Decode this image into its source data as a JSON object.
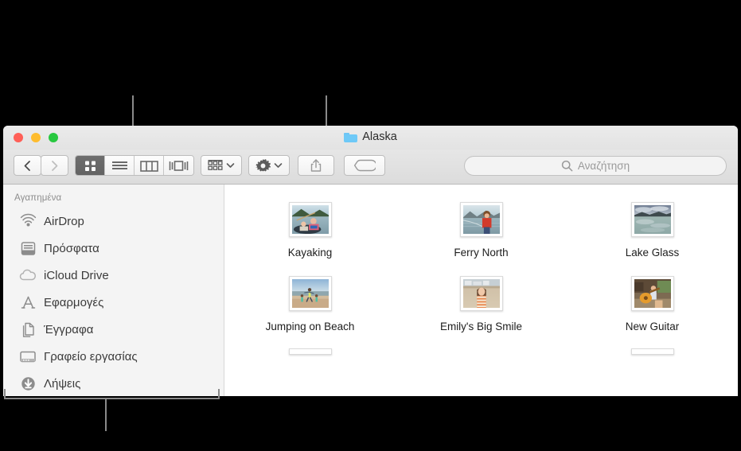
{
  "window": {
    "title": "Alaska",
    "folder_icon": "folder-icon",
    "traffic_lights": {
      "close": "#ff5f57",
      "minimize": "#febc2e",
      "maximize": "#28c840"
    }
  },
  "toolbar": {
    "back_label": "‹",
    "forward_label": "›",
    "view_modes": [
      {
        "name": "icon-view",
        "icon": "grid-icon",
        "selected": true
      },
      {
        "name": "list-view",
        "icon": "list-icon",
        "selected": false
      },
      {
        "name": "column-view",
        "icon": "columns-icon",
        "selected": false
      },
      {
        "name": "gallery-view",
        "icon": "coverflow-icon",
        "selected": false
      }
    ],
    "arrange_button": {
      "name": "arrange-button",
      "icon": "arrange-grid-icon"
    },
    "action_button": {
      "name": "action-button",
      "icon": "gear-icon"
    },
    "share_button": {
      "name": "share-button",
      "icon": "share-upload-icon"
    },
    "tags_button": {
      "name": "tags-button",
      "icon": "tag-icon"
    }
  },
  "search": {
    "placeholder": "Αναζήτηση",
    "value": "",
    "icon": "search-icon"
  },
  "sidebar": {
    "header": "Αγαπημένα",
    "items": [
      {
        "label": "AirDrop",
        "icon": "airdrop-icon"
      },
      {
        "label": "Πρόσφατα",
        "icon": "recents-icon"
      },
      {
        "label": "iCloud Drive",
        "icon": "cloud-icon"
      },
      {
        "label": "Εφαρμογές",
        "icon": "applications-icon"
      },
      {
        "label": "Έγγραφα",
        "icon": "documents-icon"
      },
      {
        "label": "Γραφείο εργασίας",
        "icon": "desktop-icon"
      },
      {
        "label": "Λήψεις",
        "icon": "downloads-icon"
      }
    ]
  },
  "content": {
    "rows": [
      [
        {
          "label": "Kayaking",
          "thumb": "kayaking-photo"
        },
        {
          "label": "Ferry North",
          "thumb": "ferry-north-photo"
        },
        {
          "label": "Lake Glass",
          "thumb": "lake-glass-photo"
        }
      ],
      [
        {
          "label": "Jumping on Beach",
          "thumb": "jumping-on-beach-photo"
        },
        {
          "label": "Emily's Big Smile",
          "thumb": "emilys-big-smile-photo"
        },
        {
          "label": "New Guitar",
          "thumb": "new-guitar-photo"
        }
      ]
    ]
  },
  "callouts": {
    "view_buttons_pointer": "points to the view-mode button group",
    "share_button_pointer": "points to the share and tags buttons",
    "sidebar_pointer": "points to the sidebar"
  }
}
